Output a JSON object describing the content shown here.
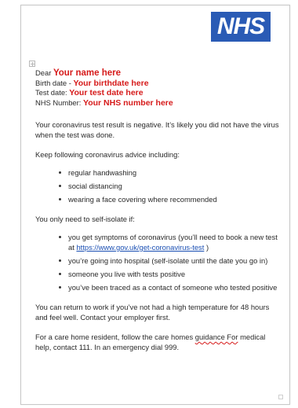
{
  "logo": {
    "text": "NHS",
    "color": "#2a5bb5"
  },
  "fields": [
    {
      "label": "Dear",
      "value": "Your name here"
    },
    {
      "label": "Birth date -",
      "value": "Your birthdate here"
    },
    {
      "label": "Test date:",
      "value": "Your test date here"
    },
    {
      "label": "NHS Number:",
      "value": "Your NHS number here"
    }
  ],
  "result_text": "Your coronavirus test result is negative. It’s likely you did not have the virus when the test was done.",
  "advice_heading": "Keep following coronavirus advice including:",
  "advice_items": [
    "regular handwashing",
    "social distancing",
    "wearing a face covering where recommended"
  ],
  "isolate_heading": "You only need to self-isolate if:",
  "isolate_items": {
    "item1_before": "you get symptoms of coronavirus (you’ll need to book a new test at ",
    "item1_link": "https://www.gov.uk/get-coronavirus-test",
    "item1_after": " )",
    "item2": "you’re going into hospital (self-isolate until the date you go in)",
    "item3": "someone you live with tests positive",
    "item4": "you’ve been traced as a contact of someone who tested positive"
  },
  "return_text": "You can return to work if you’ve not had a high temperature for 48 hours and feel well. Contact your employer first.",
  "care_home": {
    "before": "For a care home resident, follow the care homes ",
    "underlined": "guidance For",
    "after": " medical help, contact 111. In an emergency dial 999."
  },
  "colors": {
    "placeholder": "#d61a1a",
    "link": "#1a4fb3",
    "text": "#2a2a2a"
  }
}
